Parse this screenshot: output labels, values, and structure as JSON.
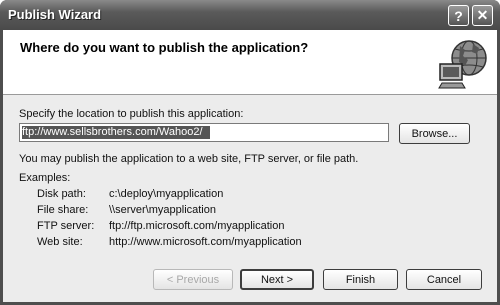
{
  "window": {
    "title": "Publish Wizard",
    "help_glyph": "?",
    "close_glyph": "✕"
  },
  "header": {
    "title": "Where do you want to publish the application?",
    "icon": "globe-computer-icon"
  },
  "location": {
    "label": "Specify the location to publish this application:",
    "value": "ftp://www.sellsbrothers.com/Wahoo2/",
    "browse_label": "Browse..."
  },
  "info_text": "You may publish the application to a web site, FTP server, or file path.",
  "examples": {
    "heading": "Examples:",
    "items": [
      {
        "key": "Disk path:",
        "value": "c:\\deploy\\myapplication"
      },
      {
        "key": "File share:",
        "value": "\\\\server\\myapplication"
      },
      {
        "key": "FTP server:",
        "value": "ftp://ftp.microsoft.com/myapplication"
      },
      {
        "key": "Web site:",
        "value": "http://www.microsoft.com/myapplication"
      }
    ]
  },
  "buttons": {
    "previous": "< Previous",
    "next": "Next >",
    "finish": "Finish",
    "cancel": "Cancel"
  }
}
